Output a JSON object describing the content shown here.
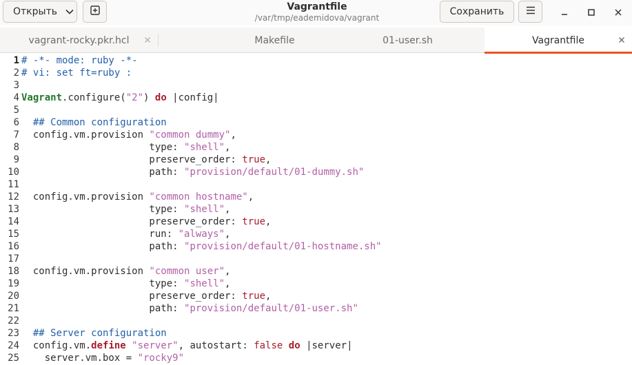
{
  "header": {
    "open_label": "Открыть",
    "save_label": "Сохранить",
    "title": "Vagrantfile",
    "subtitle": "/var/tmp/eademidova/vagrant"
  },
  "tabs": [
    {
      "label": "vagrant-rocky.pkr.hcl",
      "active": false
    },
    {
      "label": "Makefile",
      "active": false
    },
    {
      "label": "01-user.sh",
      "active": false
    },
    {
      "label": "Vagrantfile",
      "active": true
    }
  ],
  "code": [
    {
      "n": "1",
      "spans": [
        [
          "c",
          "# -*- mode: ruby -*-"
        ]
      ]
    },
    {
      "n": "2",
      "spans": [
        [
          "c",
          "# vi: set ft=ruby :"
        ]
      ]
    },
    {
      "n": "3",
      "spans": []
    },
    {
      "n": "4",
      "spans": [
        [
          "v",
          "Vagrant"
        ],
        [
          "n",
          ".configure("
        ],
        [
          "s",
          "\"2\""
        ],
        [
          "n",
          ") "
        ],
        [
          "k",
          "do"
        ],
        [
          "n",
          " |config|"
        ]
      ]
    },
    {
      "n": "5",
      "spans": []
    },
    {
      "n": "6",
      "spans": [
        [
          "n",
          "  "
        ],
        [
          "c",
          "## Common configuration"
        ]
      ]
    },
    {
      "n": "7",
      "spans": [
        [
          "n",
          "  config.vm.provision "
        ],
        [
          "s",
          "\"common dummy\""
        ],
        [
          "n",
          ","
        ]
      ]
    },
    {
      "n": "8",
      "spans": [
        [
          "n",
          "                      type: "
        ],
        [
          "s",
          "\"shell\""
        ],
        [
          "n",
          ","
        ]
      ]
    },
    {
      "n": "9",
      "spans": [
        [
          "n",
          "                      preserve_order: "
        ],
        [
          "b",
          "true"
        ],
        [
          "n",
          ","
        ]
      ]
    },
    {
      "n": "10",
      "spans": [
        [
          "n",
          "                      path: "
        ],
        [
          "s",
          "\"provision/default/01-dummy.sh\""
        ]
      ]
    },
    {
      "n": "11",
      "spans": []
    },
    {
      "n": "12",
      "spans": [
        [
          "n",
          "  config.vm.provision "
        ],
        [
          "s",
          "\"common hostname\""
        ],
        [
          "n",
          ","
        ]
      ]
    },
    {
      "n": "13",
      "spans": [
        [
          "n",
          "                      type: "
        ],
        [
          "s",
          "\"shell\""
        ],
        [
          "n",
          ","
        ]
      ]
    },
    {
      "n": "14",
      "spans": [
        [
          "n",
          "                      preserve_order: "
        ],
        [
          "b",
          "true"
        ],
        [
          "n",
          ","
        ]
      ]
    },
    {
      "n": "15",
      "spans": [
        [
          "n",
          "                      run: "
        ],
        [
          "s",
          "\"always\""
        ],
        [
          "n",
          ","
        ]
      ]
    },
    {
      "n": "16",
      "spans": [
        [
          "n",
          "                      path: "
        ],
        [
          "s",
          "\"provision/default/01-hostname.sh\""
        ]
      ]
    },
    {
      "n": "17",
      "spans": []
    },
    {
      "n": "18",
      "spans": [
        [
          "n",
          "  config.vm.provision "
        ],
        [
          "s",
          "\"common user\""
        ],
        [
          "n",
          ","
        ]
      ]
    },
    {
      "n": "19",
      "spans": [
        [
          "n",
          "                      type: "
        ],
        [
          "s",
          "\"shell\""
        ],
        [
          "n",
          ","
        ]
      ]
    },
    {
      "n": "20",
      "spans": [
        [
          "n",
          "                      preserve_order: "
        ],
        [
          "b",
          "true"
        ],
        [
          "n",
          ","
        ]
      ]
    },
    {
      "n": "21",
      "spans": [
        [
          "n",
          "                      path: "
        ],
        [
          "s",
          "\"provision/default/01-user.sh\""
        ]
      ]
    },
    {
      "n": "22",
      "spans": []
    },
    {
      "n": "23",
      "spans": [
        [
          "n",
          "  "
        ],
        [
          "c",
          "## Server configuration"
        ]
      ]
    },
    {
      "n": "24",
      "spans": [
        [
          "n",
          "  config.vm."
        ],
        [
          "k",
          "define"
        ],
        [
          "n",
          " "
        ],
        [
          "s",
          "\"server\""
        ],
        [
          "n",
          ", autostart: "
        ],
        [
          "b",
          "false"
        ],
        [
          "n",
          " "
        ],
        [
          "k",
          "do"
        ],
        [
          "n",
          " |server|"
        ]
      ]
    },
    {
      "n": "25",
      "spans": [
        [
          "n",
          "    server.vm.box = "
        ],
        [
          "s",
          "\"rocky9\""
        ]
      ]
    }
  ]
}
